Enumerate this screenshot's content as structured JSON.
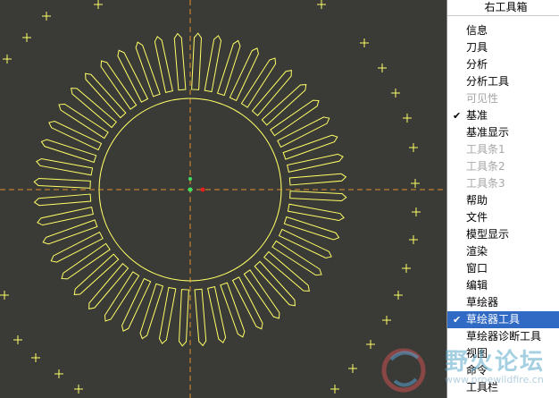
{
  "menu": {
    "title": "右工具箱",
    "items": [
      {
        "label": "信息",
        "checked": false,
        "disabled": false,
        "selected": false
      },
      {
        "label": "刀具",
        "checked": false,
        "disabled": false,
        "selected": false
      },
      {
        "label": "分析",
        "checked": false,
        "disabled": false,
        "selected": false
      },
      {
        "label": "分析工具",
        "checked": false,
        "disabled": false,
        "selected": false
      },
      {
        "label": "可见性",
        "checked": false,
        "disabled": true,
        "selected": false
      },
      {
        "label": "基准",
        "checked": true,
        "disabled": false,
        "selected": false
      },
      {
        "label": "基准显示",
        "checked": false,
        "disabled": false,
        "selected": false
      },
      {
        "label": "工具条1",
        "checked": false,
        "disabled": true,
        "selected": false
      },
      {
        "label": "工具条2",
        "checked": false,
        "disabled": true,
        "selected": false
      },
      {
        "label": "工具条3",
        "checked": false,
        "disabled": true,
        "selected": false
      },
      {
        "label": "帮助",
        "checked": false,
        "disabled": false,
        "selected": false
      },
      {
        "label": "文件",
        "checked": false,
        "disabled": false,
        "selected": false
      },
      {
        "label": "模型显示",
        "checked": false,
        "disabled": false,
        "selected": false
      },
      {
        "label": "渲染",
        "checked": false,
        "disabled": false,
        "selected": false
      },
      {
        "label": "窗口",
        "checked": false,
        "disabled": false,
        "selected": false
      },
      {
        "label": "编辑",
        "checked": false,
        "disabled": false,
        "selected": false
      },
      {
        "label": "草绘器",
        "checked": false,
        "disabled": false,
        "selected": false
      },
      {
        "label": "草绘器工具",
        "checked": true,
        "disabled": false,
        "selected": true
      },
      {
        "label": "草绘器诊断工具",
        "checked": false,
        "disabled": false,
        "selected": false
      },
      {
        "label": "视图",
        "checked": false,
        "disabled": false,
        "selected": false
      },
      {
        "label": "命令",
        "checked": false,
        "disabled": false,
        "selected": false
      },
      {
        "label": "工具栏",
        "checked": false,
        "disabled": false,
        "selected": false
      }
    ]
  },
  "watermark": {
    "text": "野火论坛",
    "url": "www.proewildfire.cn"
  },
  "colors": {
    "canvas_bg": "#3a3a36",
    "sketch": "#ffff66",
    "centerline": "#e0902a",
    "selection": "#316ac5",
    "point": "#40e060",
    "origin": "#e02020"
  },
  "icons": [
    "check-icon",
    "fire-logo-icon"
  ]
}
